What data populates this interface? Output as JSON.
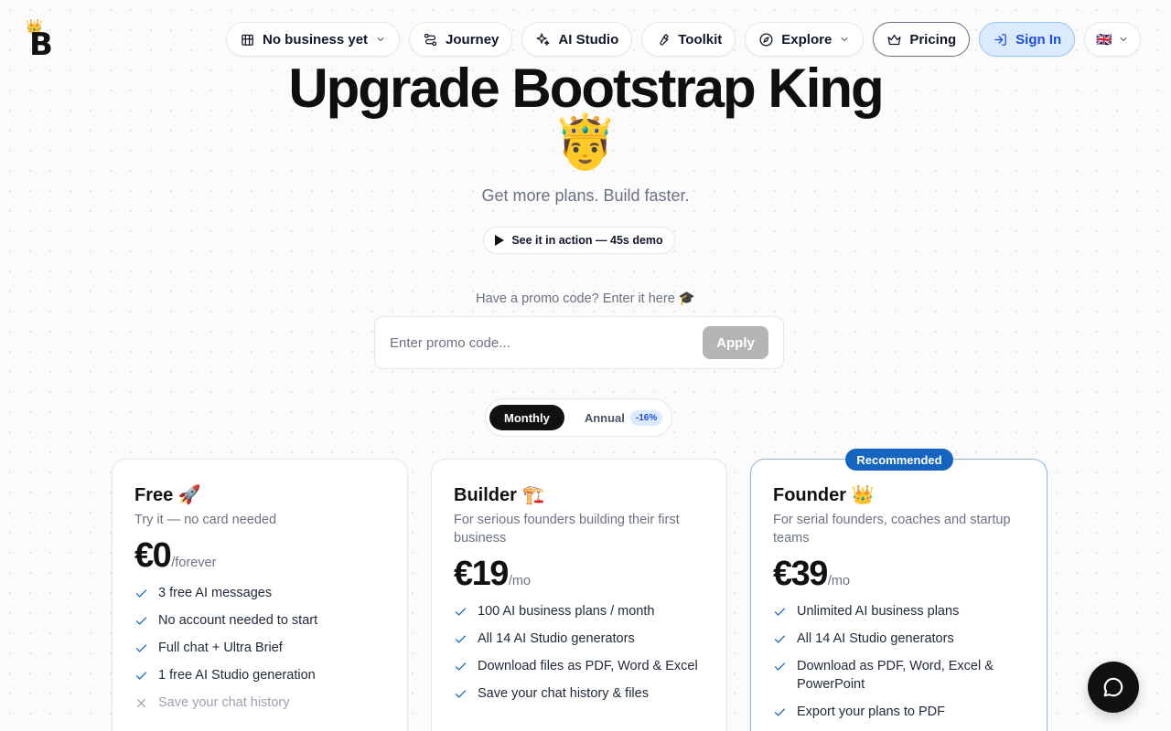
{
  "brand": {
    "logo_letter": "B",
    "logo_crown": "👑"
  },
  "nav": {
    "business": "No business yet",
    "journey": "Journey",
    "ai_studio": "AI Studio",
    "toolkit": "Toolkit",
    "explore": "Explore",
    "pricing": "Pricing",
    "sign_in": "Sign In",
    "language_flag": "🇬🇧"
  },
  "hero": {
    "title": "Upgrade Bootstrap King",
    "emoji": "🤴",
    "subtitle": "Get more plans. Build faster.",
    "demo_label": "See it in action — 45s demo"
  },
  "promo": {
    "label": "Have a promo code? Enter it here 🎓",
    "placeholder": "Enter promo code...",
    "apply_label": "Apply"
  },
  "billing": {
    "monthly": "Monthly",
    "annual": "Annual",
    "annual_discount": "-16%",
    "selected": "Monthly"
  },
  "plans": [
    {
      "name": "Free 🚀",
      "description": "Try it — no card needed",
      "price": "€0",
      "period": "/forever",
      "features": [
        {
          "text": "3 free AI messages",
          "included": true
        },
        {
          "text": "No account needed to start",
          "included": true
        },
        {
          "text": "Full chat + Ultra Brief",
          "included": true
        },
        {
          "text": "1 free AI Studio generation",
          "included": true
        },
        {
          "text": "Save your chat history",
          "included": false
        }
      ]
    },
    {
      "name": "Builder 🏗️",
      "description": "For serious founders building their first business",
      "price": "€19",
      "period": "/mo",
      "features": [
        {
          "text": "100 AI business plans / month",
          "included": true
        },
        {
          "text": "All 14 AI Studio generators",
          "included": true
        },
        {
          "text": "Download files as PDF, Word & Excel",
          "included": true
        },
        {
          "text": "Save your chat history & files",
          "included": true
        }
      ]
    },
    {
      "name": "Founder 👑",
      "badge": "Recommended",
      "description": "For serial founders, coaches and startup teams",
      "price": "€39",
      "period": "/mo",
      "features": [
        {
          "text": "Unlimited AI business plans",
          "included": true
        },
        {
          "text": "All 14 AI Studio generators",
          "included": true
        },
        {
          "text": "Download as PDF, Word, Excel & PowerPoint",
          "included": true
        },
        {
          "text": "Export your plans to PDF",
          "included": true
        }
      ]
    }
  ],
  "icons": {
    "business": "building-icon",
    "journey": "route-icon",
    "ai_studio": "sparkles-icon",
    "toolkit": "wrench-icon",
    "explore": "compass-icon",
    "pricing": "crown-icon",
    "sign_in": "login-icon",
    "chat": "chat-bubble-icon"
  },
  "colors": {
    "accent": "#1565c0",
    "signin_bg": "#dbeafe",
    "apply_disabled": "#b5b5b5",
    "toggle_active": "#111111"
  }
}
